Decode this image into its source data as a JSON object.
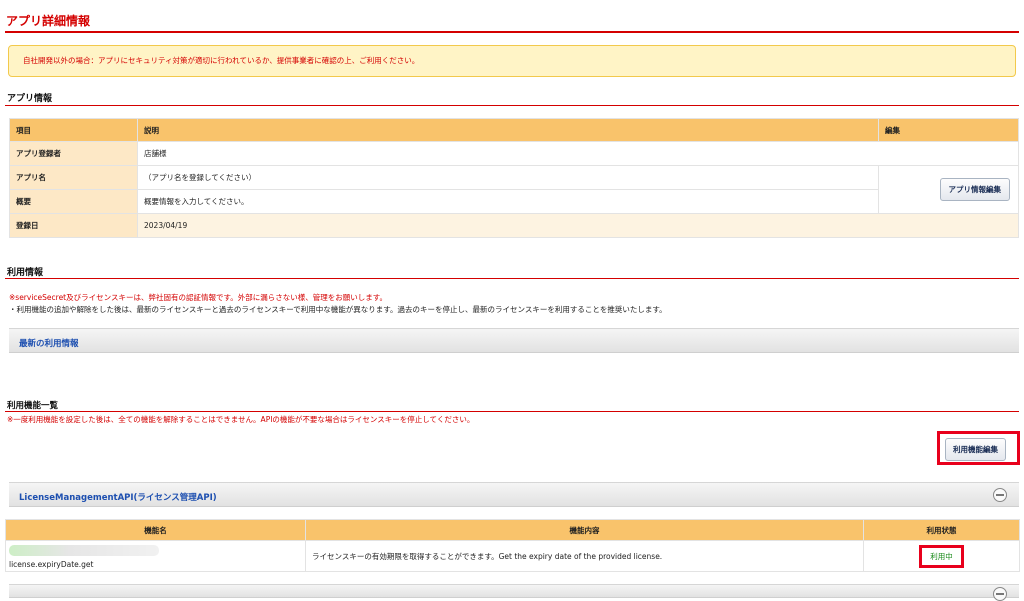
{
  "page": {
    "title": "アプリ詳細情報",
    "warning": "自社開発以外の場合：アプリにセキュリティ対策が適切に行われているか、提供事業者に確認の上、ご利用ください。"
  },
  "app_info": {
    "section_title": "アプリ情報",
    "headers": {
      "item": "項目",
      "description": "説明",
      "edit": "編集"
    },
    "rows": [
      {
        "label": "アプリ登録者",
        "value": "店舗様"
      },
      {
        "label": "アプリ名",
        "value": "（アプリ名を登録してください）"
      },
      {
        "label": "概要",
        "value": "概要情報を入力してください。"
      },
      {
        "label": "登録日",
        "value": "2023/04/19"
      }
    ],
    "edit_button": "アプリ情報編集"
  },
  "usage_info": {
    "section_title": "利用情報",
    "notice_red": "※serviceSecret及びライセンスキーは、弊社固有の認証情報です。外部に漏らさない様、管理をお願いします。",
    "notice_black": "・利用機能の追加や解除をした後は、最新のライセンスキーと過去のライセンスキーで利用中な機能が異なります。過去のキーを停止し、最新のライセンスキーを利用することを推奨いたします。",
    "latest_bar": "最新の利用情報"
  },
  "functions": {
    "section_title": "利用機能一覧",
    "notice": "※一度利用機能を設定した後は、全ての機能を解除することはできません。APIの機能が不要な場合はライセンスキーを停止してください。",
    "edit_button": "利用機能編集",
    "group_title": "LicenseManagementAPI(ライセンス管理API)",
    "headers": {
      "name": "機能名",
      "content": "機能内容",
      "status": "利用状態"
    },
    "rows": [
      {
        "name": "license.expiryDate.get",
        "content": "ライセンスキーの有効期限を取得することができます。Get the expiry date of the provided license.",
        "status": "利用中"
      }
    ]
  },
  "colors": {
    "accent_red": "#d40000",
    "table_header": "#f9c36b",
    "link_blue": "#1d4fb0",
    "status_green": "#1a8a1a"
  }
}
